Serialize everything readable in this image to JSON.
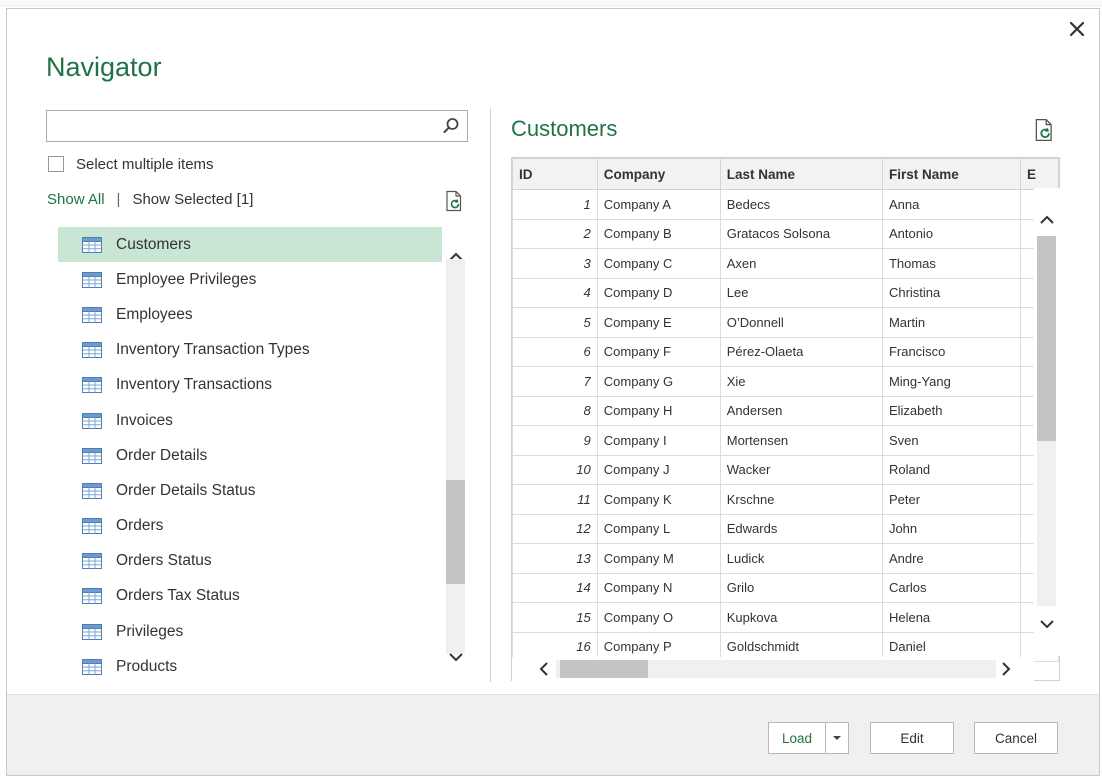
{
  "dialog": {
    "title": "Navigator",
    "close_label": "✕"
  },
  "left": {
    "search": {
      "value": "",
      "placeholder": ""
    },
    "select_multiple_label": "Select multiple items",
    "select_multiple_checked": false,
    "show_all_label": "Show All",
    "separator": "|",
    "show_selected_label": "Show Selected [1]",
    "items": [
      {
        "label": "Customers",
        "selected": true
      },
      {
        "label": "Employee Privileges",
        "selected": false
      },
      {
        "label": "Employees",
        "selected": false
      },
      {
        "label": "Inventory Transaction Types",
        "selected": false
      },
      {
        "label": "Inventory Transactions",
        "selected": false
      },
      {
        "label": "Invoices",
        "selected": false
      },
      {
        "label": "Order Details",
        "selected": false
      },
      {
        "label": "Order Details Status",
        "selected": false
      },
      {
        "label": "Orders",
        "selected": false
      },
      {
        "label": "Orders Status",
        "selected": false
      },
      {
        "label": "Orders Tax Status",
        "selected": false
      },
      {
        "label": "Privileges",
        "selected": false
      },
      {
        "label": "Products",
        "selected": false
      }
    ]
  },
  "preview": {
    "title": "Customers",
    "columns": [
      "ID",
      "Company",
      "Last Name",
      "First Name",
      "E"
    ],
    "rows": [
      [
        "1",
        "Company A",
        "Bedecs",
        "Anna"
      ],
      [
        "2",
        "Company B",
        "Gratacos Solsona",
        "Antonio"
      ],
      [
        "3",
        "Company C",
        "Axen",
        "Thomas"
      ],
      [
        "4",
        "Company D",
        "Lee",
        "Christina"
      ],
      [
        "5",
        "Company E",
        "O’Donnell",
        "Martin"
      ],
      [
        "6",
        "Company F",
        "Pérez-Olaeta",
        "Francisco"
      ],
      [
        "7",
        "Company G",
        "Xie",
        "Ming-Yang"
      ],
      [
        "8",
        "Company H",
        "Andersen",
        "Elizabeth"
      ],
      [
        "9",
        "Company I",
        "Mortensen",
        "Sven"
      ],
      [
        "10",
        "Company J",
        "Wacker",
        "Roland"
      ],
      [
        "11",
        "Company K",
        "Krschne",
        "Peter"
      ],
      [
        "12",
        "Company L",
        "Edwards",
        "John"
      ],
      [
        "13",
        "Company M",
        "Ludick",
        "Andre"
      ],
      [
        "14",
        "Company N",
        "Grilo",
        "Carlos"
      ],
      [
        "15",
        "Company O",
        "Kupkova",
        "Helena"
      ],
      [
        "16",
        "Company P",
        "Goldschmidt",
        "Daniel"
      ]
    ]
  },
  "footer": {
    "load_label": "Load",
    "edit_label": "Edit",
    "cancel_label": "Cancel"
  },
  "colors": {
    "accent": "#217346",
    "selected_bg": "#c9e6d4"
  },
  "icons": {
    "search": "search-icon",
    "refresh": "refresh-icon",
    "table": "table-icon",
    "close": "close-icon"
  }
}
